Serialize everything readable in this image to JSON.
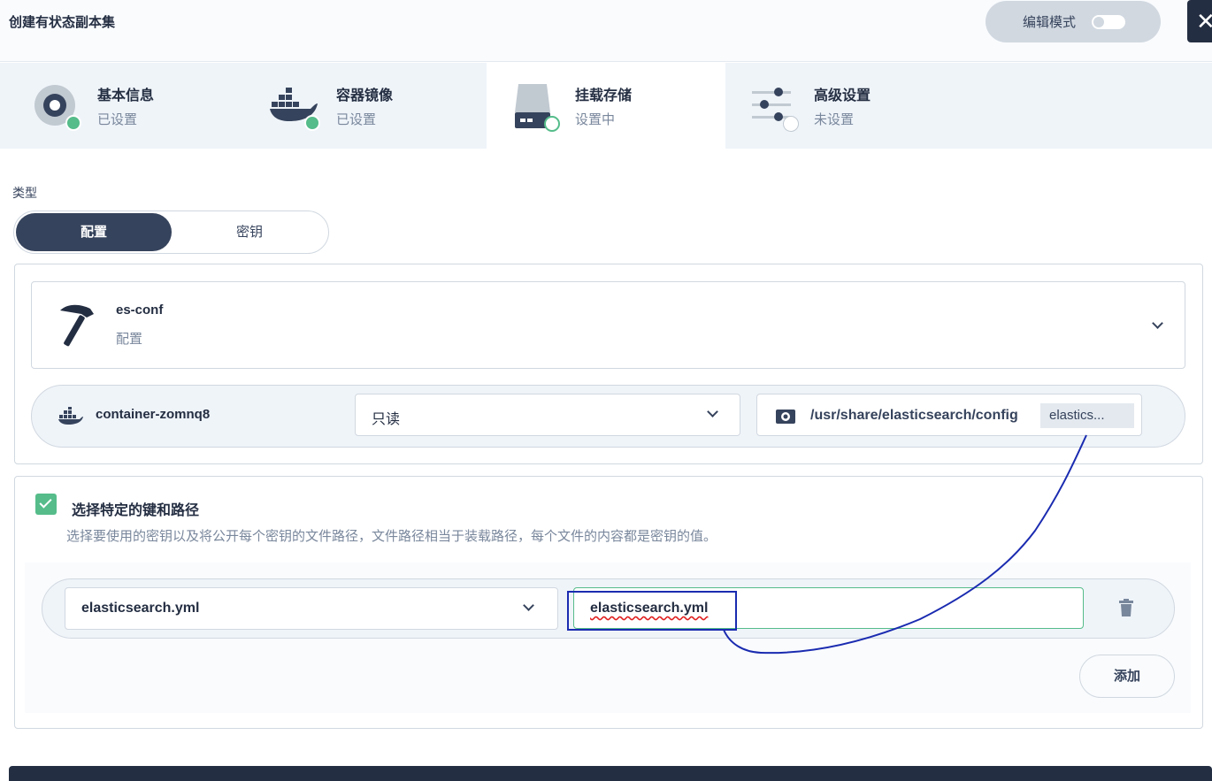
{
  "header": {
    "title": "创建有状态副本集",
    "edit_mode_label": "编辑模式",
    "close_glyph": "✕"
  },
  "steps": [
    {
      "title": "基本信息",
      "status": "已设置"
    },
    {
      "title": "容器镜像",
      "status": "已设置"
    },
    {
      "title": "挂载存储",
      "status": "设置中"
    },
    {
      "title": "高级设置",
      "status": "未设置"
    }
  ],
  "type_section": {
    "label": "类型",
    "options": [
      "配置",
      "密钥"
    ],
    "selected": "配置"
  },
  "resource": {
    "name": "es-conf",
    "type": "配置"
  },
  "mount": {
    "container": "container-zomnq8",
    "access_mode": "只读",
    "path": "/usr/share/elasticsearch/config",
    "path_tag": "elastics..."
  },
  "key_selection": {
    "checkbox_label": "选择特定的键和路径",
    "checked": true,
    "description": "选择要使用的密钥以及将公开每个密钥的文件路径，文件路径相当于装载路径，每个文件的内容都是密钥的值。",
    "rows": [
      {
        "key": "elasticsearch.yml",
        "path": "elasticsearch.yml"
      }
    ],
    "add_label": "添加"
  },
  "colors": {
    "accent_green": "#55bc8a",
    "dark": "#242e42",
    "annotation_blue": "#1a2bb0"
  }
}
